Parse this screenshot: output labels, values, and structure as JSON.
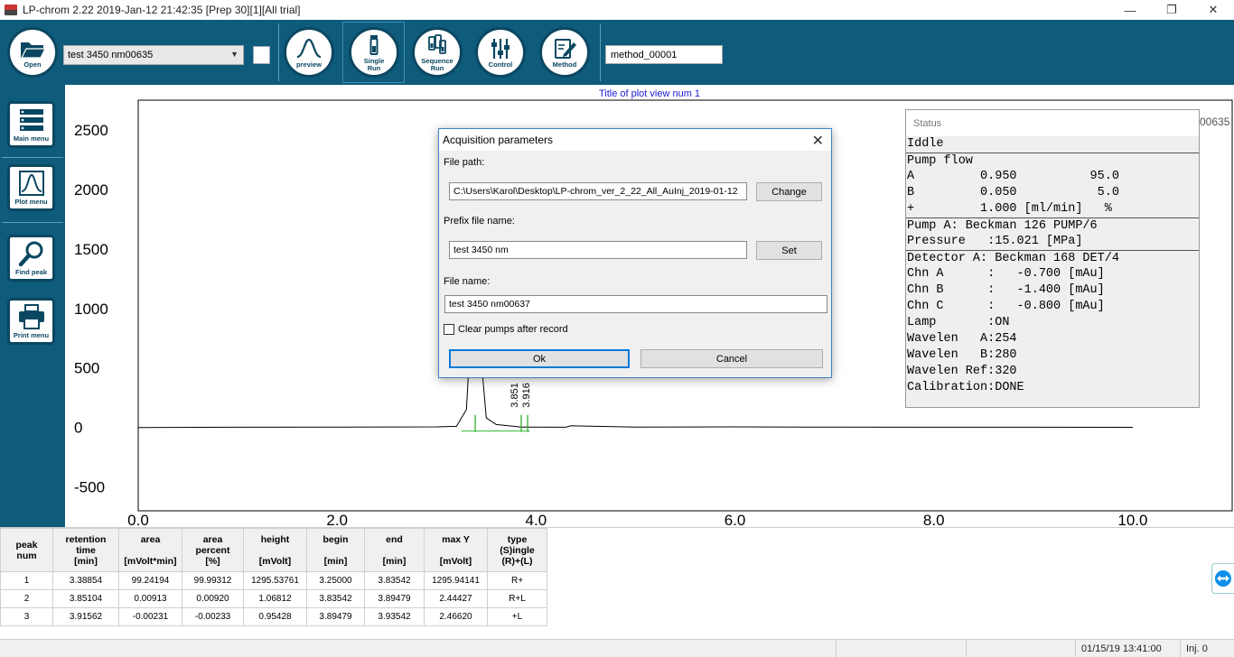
{
  "window": {
    "title": "LP-chrom 2.22 2019-Jan-12 21:42:35 [Prep 30][1][All trial]",
    "minimize_glyph": "—",
    "restore_glyph": "❐",
    "close_glyph": "✕"
  },
  "toolbar": {
    "open_label": "Open",
    "sample_select_value": "test 3450 nm00635",
    "preview_label": "preview",
    "single_run_label": "Single\nRun",
    "sequence_run_label": "Sequence\nRun",
    "control_label": "Control",
    "method_label": "Method",
    "method_value": "method_00001"
  },
  "sidebar": {
    "main_menu_label": "Main menu",
    "plot_menu_label": "Plot menu",
    "find_peak_label": "Find peak",
    "print_menu_label": "Print menu"
  },
  "plot": {
    "title": "Title of plot view num 1",
    "y_ticks": [
      "2500",
      "2000",
      "1500",
      "1000",
      "500",
      "0",
      "-500"
    ],
    "x_ticks": [
      "0.0",
      "2.0",
      "4.0",
      "6.0",
      "8.0",
      "10.0"
    ],
    "peak_labels": [
      "3.851",
      "3.916"
    ],
    "clipped_filename_fragment": "00635"
  },
  "chart_data": {
    "type": "line",
    "title": "Title of plot view num 1",
    "xlabel": "",
    "ylabel": "",
    "xlim": [
      0,
      11
    ],
    "ylim": [
      -700,
      2750
    ],
    "x": [
      0.0,
      1.0,
      2.0,
      3.0,
      3.2,
      3.3,
      3.35,
      3.38854,
      3.42,
      3.5,
      3.6,
      3.8,
      3.85104,
      3.91562,
      4.3,
      4.35,
      5.0,
      6.0,
      7.0,
      8.0,
      9.0,
      10.0
    ],
    "y": [
      0,
      2,
      3,
      5,
      10,
      150,
      900,
      1295.5,
      850,
      80,
      25,
      8,
      3,
      3,
      2,
      14,
      4,
      5,
      3,
      2,
      2,
      1
    ],
    "peaks_rt": [
      3.38854,
      3.85104,
      3.91562
    ],
    "grid": false,
    "legend": "none"
  },
  "status": {
    "header": "Status",
    "lines": [
      "Iddle",
      "Pump flow",
      "A         0.950          95.0",
      "B         0.050           5.0",
      "+         1.000 [ml/min]   %",
      "Pump A: Beckman 126 PUMP/6",
      "Pressure   :15.021 [MPa]",
      "Detector A: Beckman 168 DET/4",
      "Chn A      :   -0.700 [mAu]",
      "Chn B      :   -1.400 [mAu]",
      "Chn C      :   -0.800 [mAu]",
      "Lamp       :ON",
      "Wavelen   A:254",
      "Wavelen   B:280",
      "Wavelen Ref:320",
      "Calibration:DONE"
    ]
  },
  "dialog": {
    "title": "Acquisition parameters",
    "close_glyph": "✕",
    "file_path_label": "File path:",
    "file_path_value": "C:\\Users\\Karol\\Desktop\\LP-chrom_ver_2_22_All_AuInj_2019-01-12",
    "change_label": "Change",
    "prefix_label": "Prefix file name:",
    "prefix_value": "test 3450 nm",
    "set_label": "Set",
    "file_name_label": "File name:",
    "file_name_value": "test 3450 nm00637",
    "clear_pumps_label": "Clear pumps after record",
    "ok_label": "Ok",
    "cancel_label": "Cancel"
  },
  "table": {
    "headers": [
      "peak\nnum",
      "retention\ntime\n[min]",
      "area\n\n[mVolt*min]",
      "area\npercent\n[%]",
      "height\n\n[mVolt]",
      "begin\n\n[min]",
      "end\n\n[min]",
      "max Y\n\n[mVolt]",
      "type\n(S)ingle\n(R)+(L)"
    ],
    "rows": [
      [
        "1",
        "3.38854",
        "99.24194",
        "99.99312",
        "1295.53761",
        "3.25000",
        "3.83542",
        "1295.94141",
        "R+"
      ],
      [
        "2",
        "3.85104",
        "0.00913",
        "0.00920",
        "1.06812",
        "3.83542",
        "3.89479",
        "2.44427",
        "R+L"
      ],
      [
        "3",
        "3.91562",
        "-0.00231",
        "-0.00233",
        "0.95428",
        "3.89479",
        "3.93542",
        "2.46620",
        "+L"
      ]
    ]
  },
  "statusbar": {
    "datetime": "01/15/19 13:41:00",
    "injection": "Inj. 0"
  }
}
